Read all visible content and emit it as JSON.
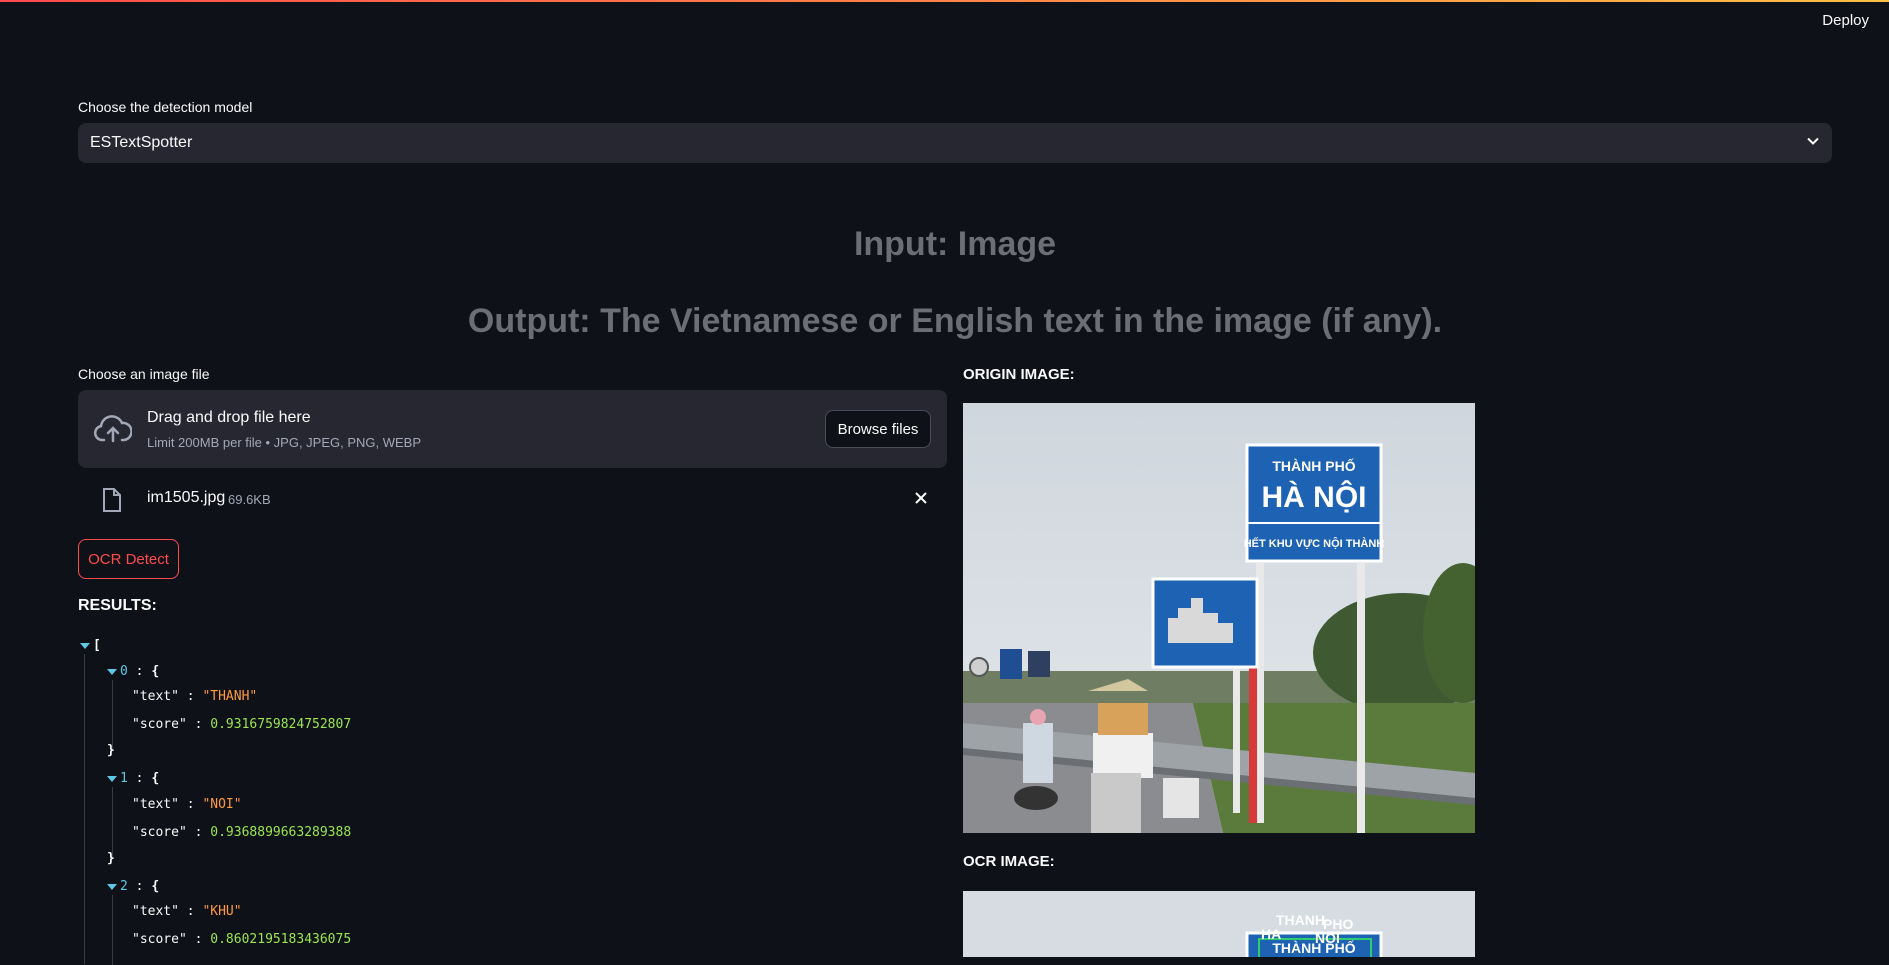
{
  "header": {
    "deploy_label": "Deploy"
  },
  "model_select": {
    "label": "Choose the detection model",
    "value": "ESTextSpotter"
  },
  "headings": {
    "input": "Input: Image",
    "output": "Output: The Vietnamese or English text in the image (if any)."
  },
  "uploader": {
    "label": "Choose an image file",
    "title": "Drag and drop file here",
    "limit": "Limit 200MB per file • JPG, JPEG, PNG, WEBP",
    "browse_label": "Browse files",
    "file_name": "im1505.jpg",
    "file_size": "69.6KB"
  },
  "ocr_button": "OCR Detect",
  "results": {
    "label": "RESULTS:",
    "items": [
      {
        "index": "0",
        "text": "\"THANH\"",
        "score": "0.9316759824752807"
      },
      {
        "index": "1",
        "text": "\"NOI\"",
        "score": "0.9368899663289388"
      },
      {
        "index": "2",
        "text": "\"KHU\"",
        "score": "0.8602195183436075"
      }
    ]
  },
  "origin_image": {
    "label": "ORIGIN IMAGE:",
    "sign_line1": "THÀNH PHỐ",
    "sign_line2": "HÀ NỘI",
    "sign_line3": "HẾT KHU VỰC NỘI THÀNH"
  },
  "ocr_image": {
    "label": "OCR IMAGE:",
    "overlay_texts": [
      "THANH",
      "PHO",
      "HA",
      "NOI"
    ],
    "sign_line1": "THÀNH PHỐ"
  },
  "colors": {
    "background": "#0e1117",
    "accent": "#ff4b4b",
    "panel": "#262730"
  }
}
